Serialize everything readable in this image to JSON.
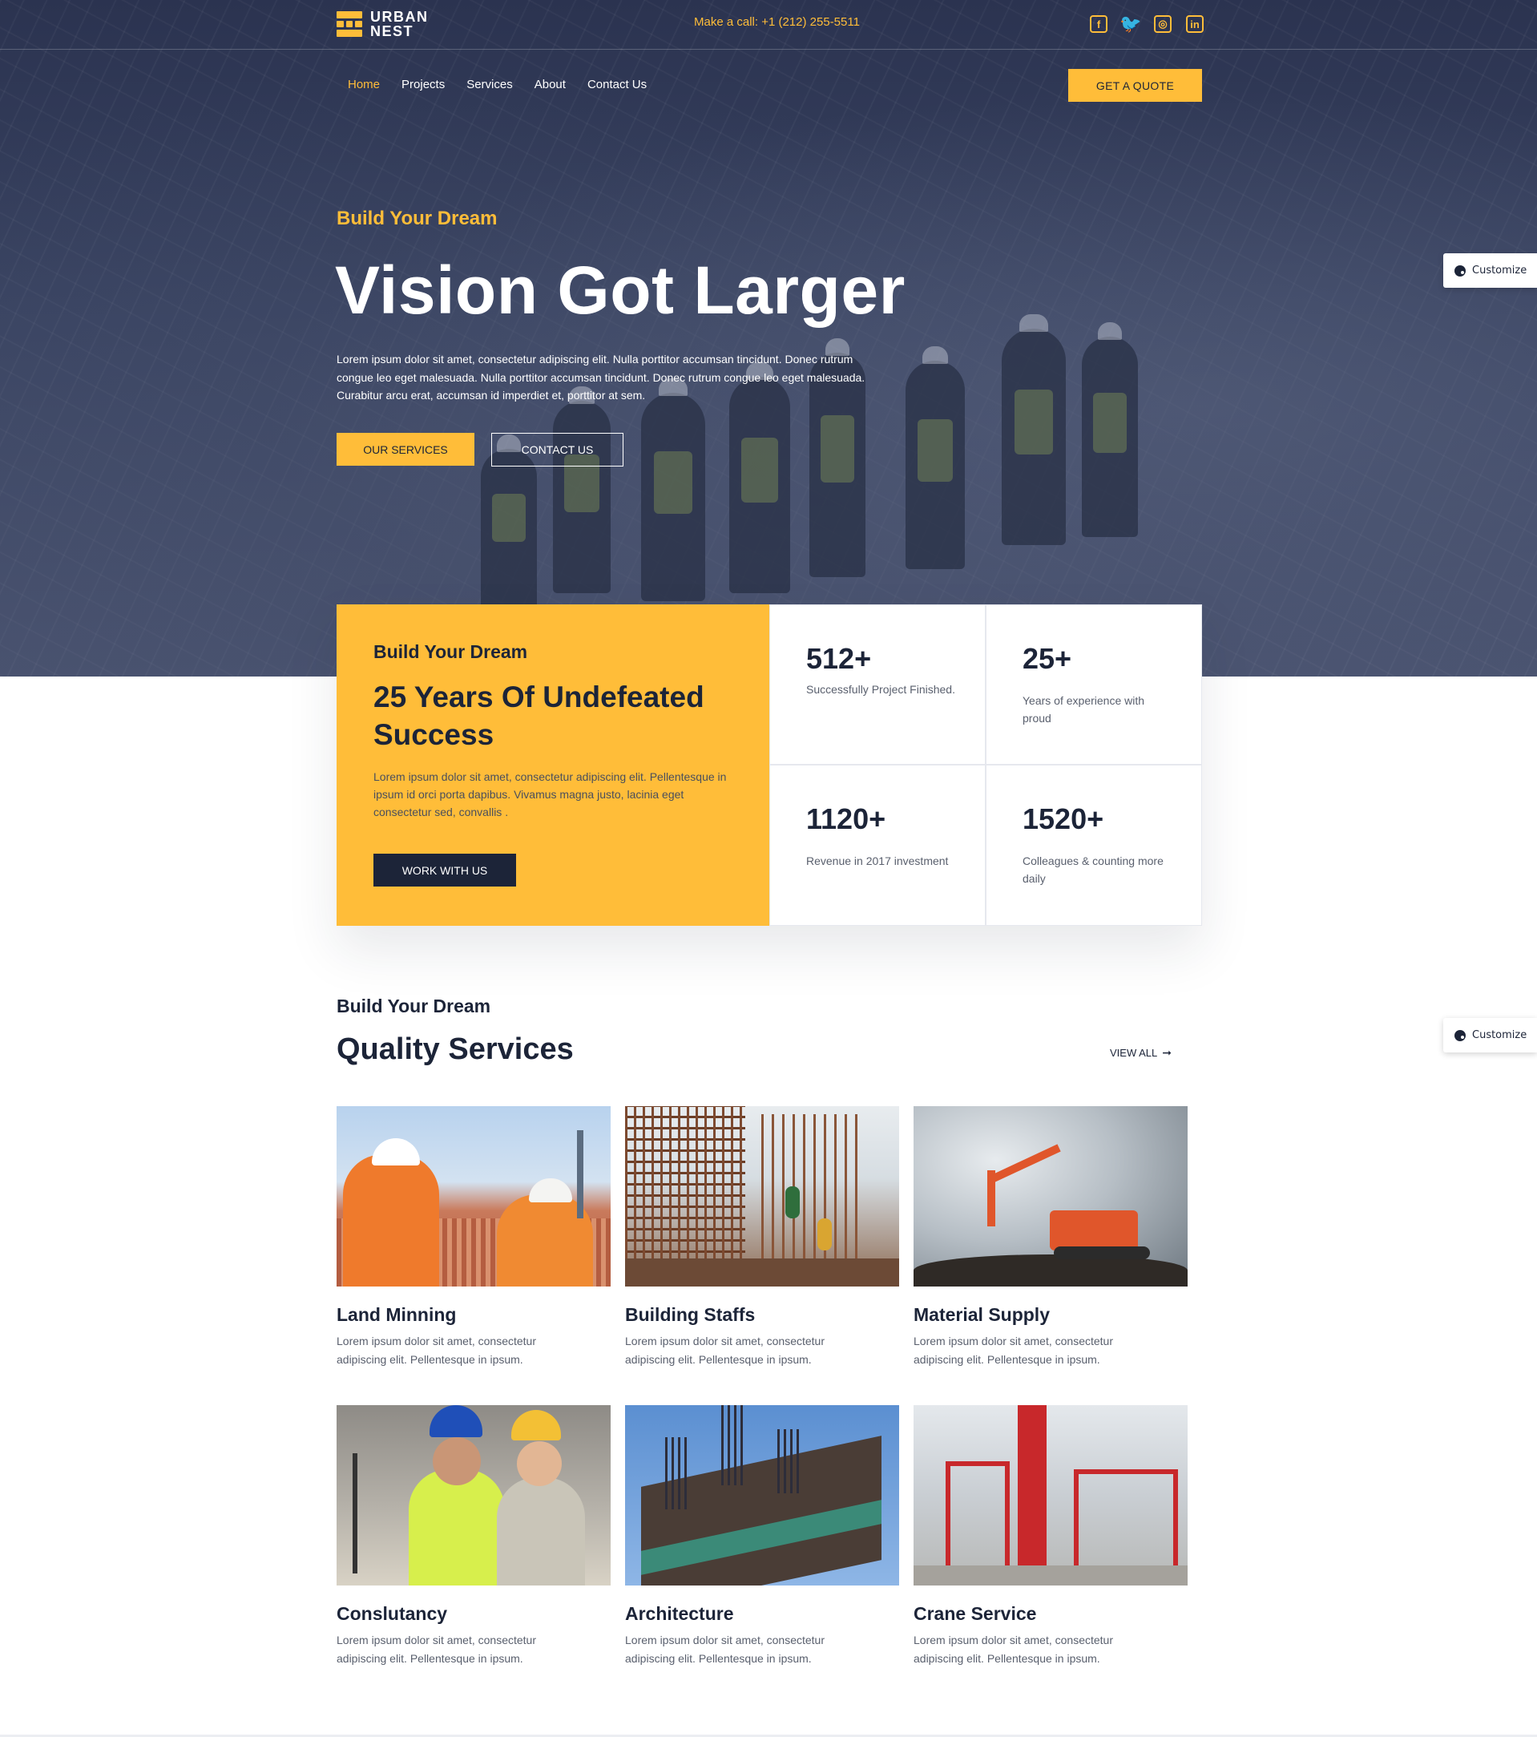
{
  "brand": {
    "line1": "URBAN",
    "line2": "NEST"
  },
  "topbar": {
    "call_text": "Make a call: +1 (212) 255-5511"
  },
  "socials": [
    {
      "icon": "facebook-icon",
      "glyph": "f"
    },
    {
      "icon": "twitter-icon",
      "glyph": "🐦"
    },
    {
      "icon": "instagram-icon",
      "glyph": "◎"
    },
    {
      "icon": "linkedin-icon",
      "glyph": "in"
    }
  ],
  "nav": {
    "items": [
      "Home",
      "Projects",
      "Services",
      "About",
      "Contact Us"
    ],
    "active": "Home",
    "quote_label": "GET A QUOTE"
  },
  "hero": {
    "eyebrow": "Build Your Dream",
    "title": "Vision Got Larger",
    "text": "Lorem ipsum dolor sit amet, consectetur adipiscing elit. Nulla porttitor accumsan tincidunt. Donec rutrum congue leo eget malesuada. Nulla porttitor accumsan tincidunt. Donec rutrum congue leo eget malesuada. Curabitur arcu erat, accumsan id imperdiet et, porttitor at sem.",
    "primary_button": "OUR SERVICES",
    "secondary_button": "CONTACT US"
  },
  "customize": {
    "label": "Customize",
    "icon": "palette-icon"
  },
  "stats": {
    "eyebrow": "Build Your Dream",
    "title": "25 Years Of Undefeated Success",
    "text": "Lorem ipsum dolor sit amet, consectetur adipiscing elit. Pellentesque in ipsum id orci porta dapibus. Vivamus magna justo, lacinia eget consectetur sed, convallis .",
    "button": "WORK WITH US",
    "items": [
      {
        "number": "512+",
        "label": "Successfully Project Finished."
      },
      {
        "number": "25+",
        "label": "Years of experience with proud"
      },
      {
        "number": "1120+",
        "label": "Revenue in 2017 investment"
      },
      {
        "number": "1520+",
        "label": "Colleagues & counting more daily"
      }
    ]
  },
  "services": {
    "eyebrow": "Build Your Dream",
    "title": "Quality Services",
    "view_all": "VIEW ALL",
    "items": [
      {
        "name": "Land Minning",
        "desc": "Lorem ipsum dolor sit amet, consectetur adipiscing elit. Pellentesque in ipsum."
      },
      {
        "name": "Building Staffs",
        "desc": "Lorem ipsum dolor sit amet, consectetur adipiscing elit. Pellentesque in ipsum."
      },
      {
        "name": "Material Supply",
        "desc": "Lorem ipsum dolor sit amet, consectetur adipiscing elit. Pellentesque in ipsum."
      },
      {
        "name": "Conslutancy",
        "desc": "Lorem ipsum dolor sit amet, consectetur adipiscing elit. Pellentesque in ipsum."
      },
      {
        "name": "Architecture",
        "desc": "Lorem ipsum dolor sit amet, consectetur adipiscing elit. Pellentesque in ipsum."
      },
      {
        "name": "Crane Service",
        "desc": "Lorem ipsum dolor sit amet, consectetur adipiscing elit. Pellentesque in ipsum."
      }
    ]
  },
  "colors": {
    "accent": "#ffbd39",
    "navy": "#1c2438",
    "hero_overlay": "#2f3854"
  }
}
